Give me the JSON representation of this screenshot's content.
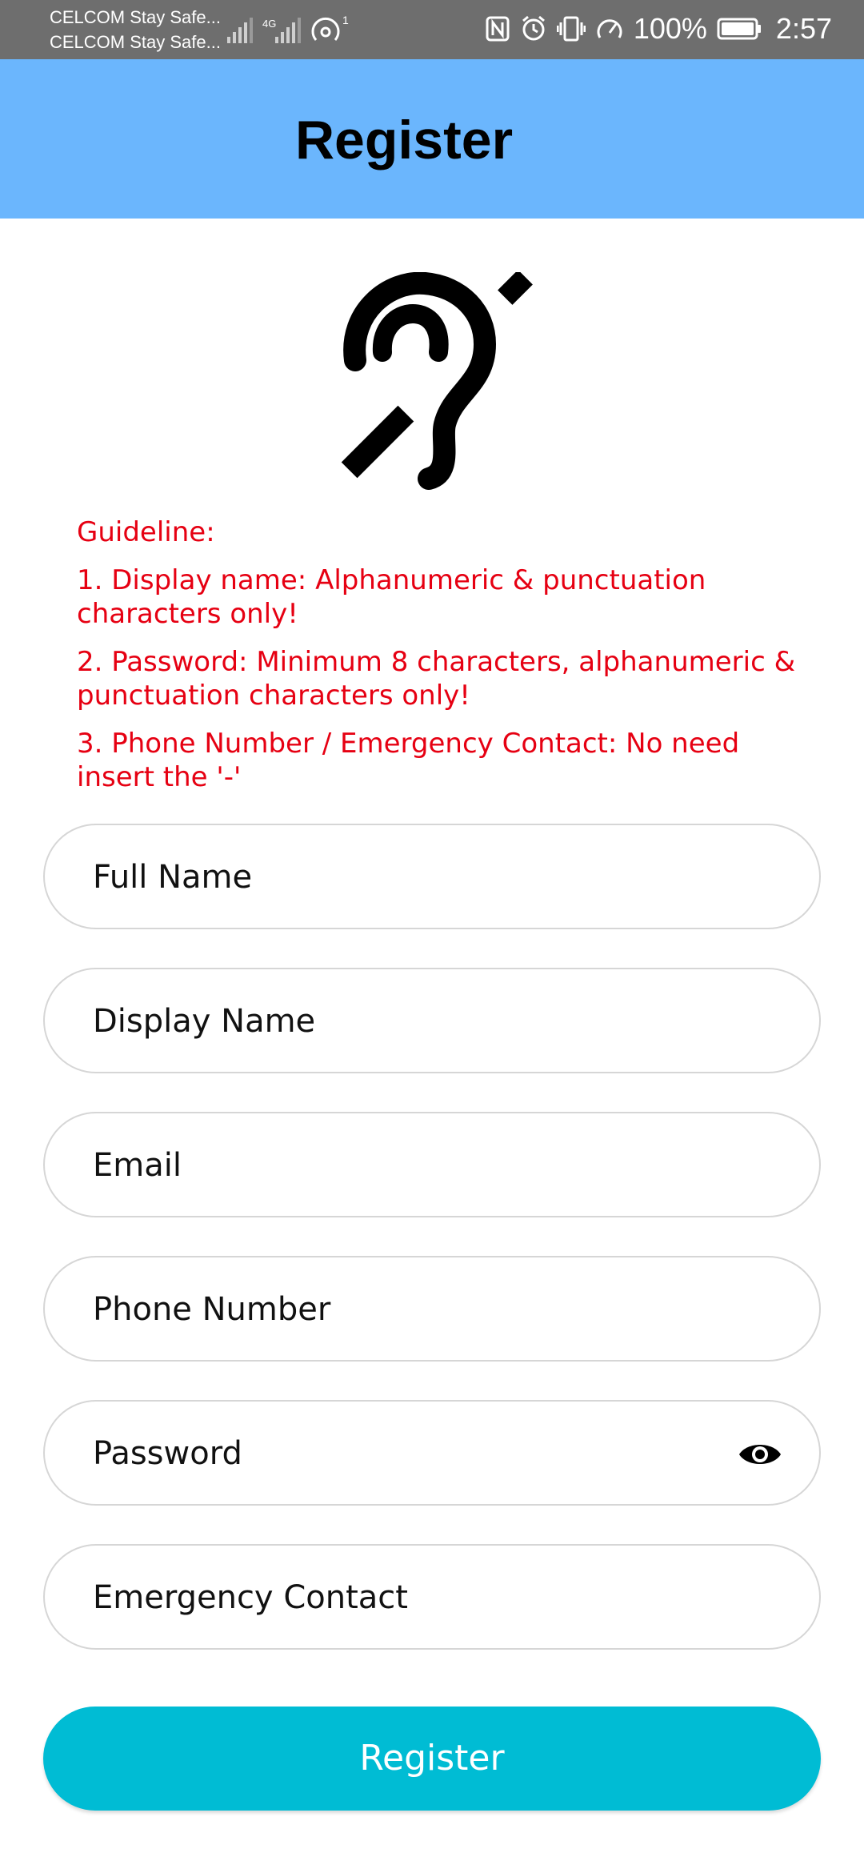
{
  "status_bar": {
    "carrier_1": "CELCOM Stay Safe...",
    "carrier_2": "CELCOM Stay Safe...",
    "network": "4G",
    "hotspot_count": "1",
    "battery": "100%",
    "time": "2:57"
  },
  "app_bar": {
    "title": "Register"
  },
  "logo": {
    "icon": "hearing-impaired-ear-icon"
  },
  "guideline": {
    "title": "Guideline:",
    "items": [
      "1. Display name: Alphanumeric & punctuation characters only!",
      "2. Password: Minimum 8 characters, alphanumeric & punctuation characters only!",
      "3. Phone Number / Emergency Contact: No need insert the '-'"
    ],
    "color": "#e60012"
  },
  "form": {
    "full_name": "Full Name",
    "display_name": "Display Name",
    "email": "Email",
    "phone_number": "Phone Number",
    "password": "Password",
    "emergency_contact": "Emergency Contact"
  },
  "register_button": {
    "label": "Register",
    "color": "#00bcd4"
  },
  "colors": {
    "app_bar": "#6bb6fd",
    "status_bar": "#6e6e6e"
  }
}
